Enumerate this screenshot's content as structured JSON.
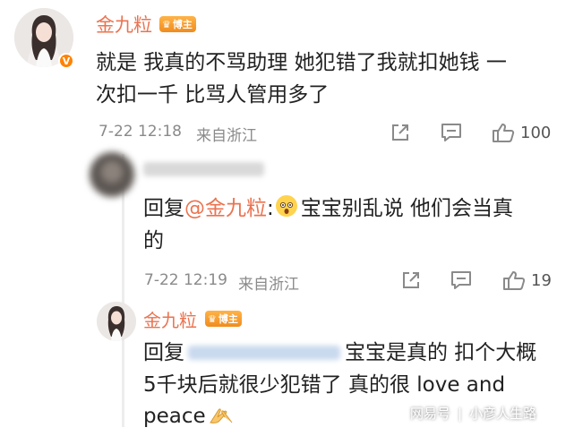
{
  "comment": {
    "username": "金九粒",
    "badge": "博主",
    "verified_mark": "V",
    "text_line1": "就是 我真的不骂助理 她犯错了我就扣她钱 一",
    "text_line2": "次扣一千 比骂人管用多了",
    "time": "7-22 12:18",
    "location": "来自浙江",
    "like_count": "100"
  },
  "reply1": {
    "prefix": "回复",
    "mention": "@金九粒",
    "colon": ":",
    "text": "宝宝别乱说 他们会当真",
    "text_line2": "的",
    "time": "7-22 12:19",
    "location": "来自浙江",
    "like_count": "19"
  },
  "reply2": {
    "username": "金九粒",
    "badge": "博主",
    "prefix": "回复",
    "text_line1_end": "宝宝是真的 扣个大概",
    "text_line2": "5千块后就很少犯错了 真的很 love and",
    "text_line3": "peace"
  },
  "watermark": {
    "platform": "网易号",
    "author": "小彦人生路"
  },
  "icons": {
    "share": "share-icon",
    "comment": "comment-icon",
    "like": "thumbs-up-icon",
    "emoji_shocked": "shocked-face-emoji",
    "emoji_hands": "folded-hands-emoji"
  }
}
